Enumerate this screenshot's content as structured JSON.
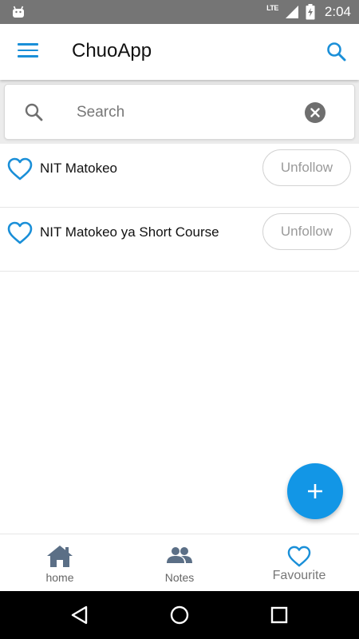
{
  "status_bar": {
    "network": "LTE",
    "time": "2:04"
  },
  "app_bar": {
    "title": "ChuoApp"
  },
  "search": {
    "placeholder": "Search",
    "value": ""
  },
  "items": [
    {
      "title": "NIT Matokeo",
      "action_label": "Unfollow"
    },
    {
      "title": "NIT Matokeo ya Short Course",
      "action_label": "Unfollow"
    }
  ],
  "fab": {
    "icon": "plus-icon"
  },
  "bottom_nav": {
    "items": [
      {
        "label": "home",
        "icon": "home-icon",
        "active": false
      },
      {
        "label": "Notes",
        "icon": "people-icon",
        "active": false
      },
      {
        "label": "Favourite",
        "icon": "heart-icon",
        "active": true
      }
    ]
  },
  "colors": {
    "accent": "#1a8fd8",
    "fab": "#1296e6",
    "status_bar": "#757575",
    "nav_icon": "#5b6f86"
  }
}
